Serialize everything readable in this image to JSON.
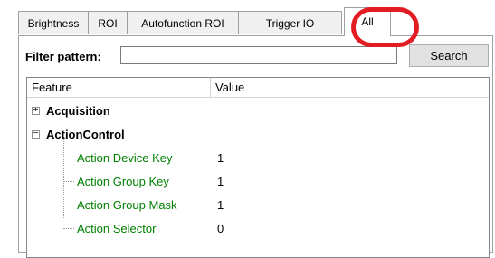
{
  "tabs": [
    {
      "label": "Brightness"
    },
    {
      "label": "ROI"
    },
    {
      "label": "Autofunction ROI"
    },
    {
      "label": "Trigger IO"
    },
    {
      "label": "All",
      "active": true
    }
  ],
  "filter": {
    "label": "Filter pattern:",
    "value": "",
    "placeholder": "",
    "search_label": "Search"
  },
  "grid": {
    "columns": [
      "Feature",
      "Value"
    ],
    "categories": [
      {
        "name": "Acquisition",
        "expander": "+",
        "expanded": false
      },
      {
        "name": "ActionControl",
        "expander": "−",
        "expanded": true
      }
    ],
    "features": [
      {
        "name": "Action Device Key",
        "value": "1"
      },
      {
        "name": "Action Group Key",
        "value": "1"
      },
      {
        "name": "Action Group Mask",
        "value": "1"
      },
      {
        "name": "Action Selector",
        "value": "0"
      }
    ]
  },
  "colors": {
    "highlight_ring": "#e31b23",
    "feature_text": "#008000"
  }
}
